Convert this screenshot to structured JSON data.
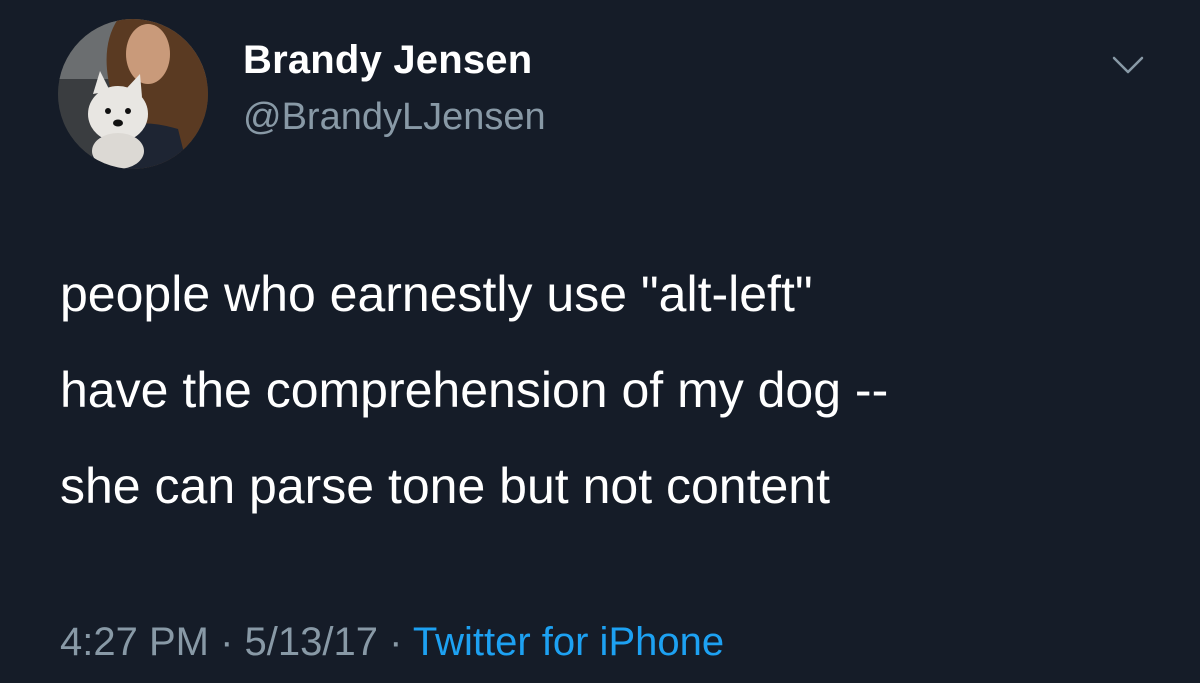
{
  "user": {
    "display_name": "Brandy Jensen",
    "handle": "@BrandyLJensen"
  },
  "tweet": {
    "lines": [
      "people who earnestly use \"alt-left\"",
      "have the comprehension of my dog --",
      "she can parse tone but not content"
    ],
    "time": "4:27 PM",
    "separator": "·",
    "date": "5/13/17",
    "source": "Twitter for iPhone"
  },
  "icons": {
    "avatar": "profile-photo-woman-with-white-dog",
    "caret": "chevron-down-icon"
  },
  "colors": {
    "background": "#151c28",
    "text_primary": "#ffffff",
    "text_secondary": "#8899a6",
    "link": "#1da1f2"
  }
}
